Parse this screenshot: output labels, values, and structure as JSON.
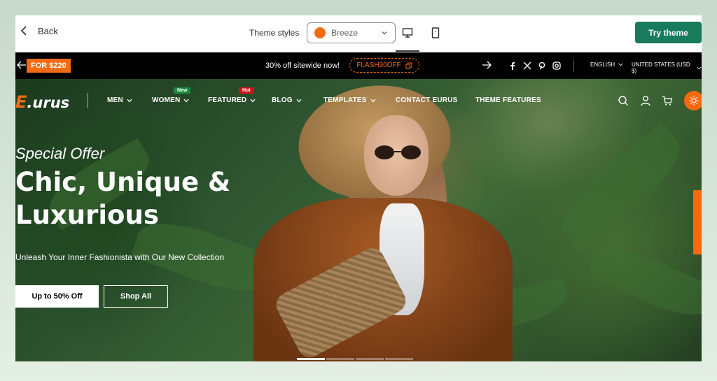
{
  "editor": {
    "back_label": "Back",
    "theme_styles_label": "Theme styles",
    "theme_select_value": "Breeze",
    "theme_dot_color": "#f36a10",
    "try_theme_label": "Try theme",
    "try_theme_color": "#1a7a5c"
  },
  "announcement": {
    "promo_tag": "FOR $220",
    "message": "30% off sitewide now!",
    "code": "FLASH30OFF",
    "language": "ENGLISH",
    "currency": "UNITED STATES (USD $)"
  },
  "header": {
    "logo_mark": "E",
    "logo_text": ".urus",
    "nav": [
      {
        "label": "MEN"
      },
      {
        "label": "WOMEN",
        "badge": "New"
      },
      {
        "label": "FEATURED",
        "badge": "Hot"
      },
      {
        "label": "BLOG"
      },
      {
        "label": "TEMPLATES"
      },
      {
        "label": "CONTACT EURUS"
      },
      {
        "label": "THEME FEATURES"
      }
    ],
    "accent_color": "#f36a10"
  },
  "hero": {
    "eyebrow": "Special Offer",
    "headline": "Chic, Unique & Luxurious",
    "subline": "Unleash Your Inner Fashionista with Our New Collection",
    "primary_button": "Up to 50% Off",
    "secondary_button": "Shop All"
  }
}
